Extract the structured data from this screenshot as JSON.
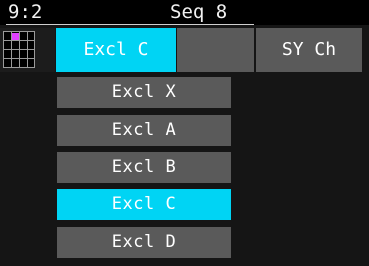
{
  "header": {
    "position": "9:2",
    "title": "Seq 8"
  },
  "pattern_icon": {
    "name": "pattern-grid-icon",
    "marker_color": "#e040ff"
  },
  "tabs": [
    {
      "label": "Excl C",
      "active": true
    },
    {
      "label": "",
      "active": false
    },
    {
      "label": "SY Ch",
      "active": false
    }
  ],
  "dropdown": {
    "items": [
      {
        "label": "Excl X",
        "selected": false
      },
      {
        "label": "Excl A",
        "selected": false
      },
      {
        "label": "Excl B",
        "selected": false
      },
      {
        "label": "Excl C",
        "selected": true
      },
      {
        "label": "Excl D",
        "selected": false
      }
    ]
  },
  "colors": {
    "accent": "#00d4f4",
    "item_background": "#5a5a5a",
    "screen_background": "#151515",
    "header_background": "#000000",
    "text": "#ffffff"
  }
}
